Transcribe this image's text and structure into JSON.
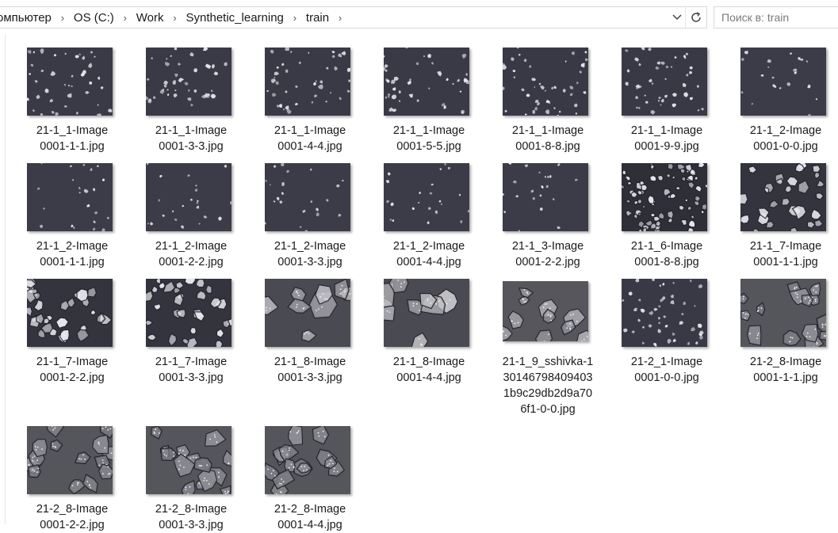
{
  "address_bar": {
    "crumbs": [
      "омпьютер",
      "OS (C:)",
      "Work",
      "Synthetic_learning",
      "train"
    ]
  },
  "search": {
    "placeholder": "Поиск в: train"
  },
  "files": [
    {
      "lines": [
        "21-1_1-Image",
        "0001-1-1.jpg"
      ],
      "style": "sparse"
    },
    {
      "lines": [
        "21-1_1-Image",
        "0001-3-3.jpg"
      ],
      "style": "sparse"
    },
    {
      "lines": [
        "21-1_1-Image",
        "0001-4-4.jpg"
      ],
      "style": "sparse"
    },
    {
      "lines": [
        "21-1_1-Image",
        "0001-5-5.jpg"
      ],
      "style": "sparse"
    },
    {
      "lines": [
        "21-1_1-Image",
        "0001-8-8.jpg"
      ],
      "style": "medium"
    },
    {
      "lines": [
        "21-1_1-Image",
        "0001-9-9.jpg"
      ],
      "style": "medium"
    },
    {
      "lines": [
        "21-1_2-Image",
        "0001-0-0.jpg"
      ],
      "style": "faint"
    },
    {
      "lines": [
        "21-1_2-Image",
        "0001-1-1.jpg"
      ],
      "style": "faint"
    },
    {
      "lines": [
        "21-1_2-Image",
        "0001-2-2.jpg"
      ],
      "style": "faint"
    },
    {
      "lines": [
        "21-1_2-Image",
        "0001-3-3.jpg"
      ],
      "style": "faint"
    },
    {
      "lines": [
        "21-1_2-Image",
        "0001-4-4.jpg"
      ],
      "style": "faint"
    },
    {
      "lines": [
        "21-1_3-Image",
        "0001-2-2.jpg"
      ],
      "style": "faint"
    },
    {
      "lines": [
        "21-1_6-Image",
        "0001-8-8.jpg"
      ],
      "style": "dense"
    },
    {
      "lines": [
        "21-1_7-Image",
        "0001-1-1.jpg"
      ],
      "style": "grains"
    },
    {
      "lines": [
        "21-1_7-Image",
        "0001-2-2.jpg"
      ],
      "style": "grains"
    },
    {
      "lines": [
        "21-1_7-Image",
        "0001-3-3.jpg"
      ],
      "style": "grains"
    },
    {
      "lines": [
        "21-1_8-Image",
        "0001-3-3.jpg"
      ],
      "style": "large"
    },
    {
      "lines": [
        "21-1_8-Image",
        "0001-4-4.jpg"
      ],
      "style": "large"
    },
    {
      "lines": [
        "21-1_9_sshivka-1",
        "30146798409403",
        "1b9c29db2d9a70",
        "6f1-0-0.jpg"
      ],
      "style": "sshivka"
    },
    {
      "lines": [
        "21-2_1-Image",
        "0001-0-0.jpg"
      ],
      "style": "medium"
    },
    {
      "lines": [
        "21-2_8-Image",
        "0001-1-1.jpg"
      ],
      "style": "textured"
    },
    {
      "lines": [
        "21-2_8-Image",
        "0001-2-2.jpg"
      ],
      "style": "textured"
    },
    {
      "lines": [
        "21-2_8-Image",
        "0001-3-3.jpg"
      ],
      "style": "textured"
    },
    {
      "lines": [
        "21-2_8-Image",
        "0001-4-4.jpg"
      ],
      "style": "textured"
    }
  ]
}
